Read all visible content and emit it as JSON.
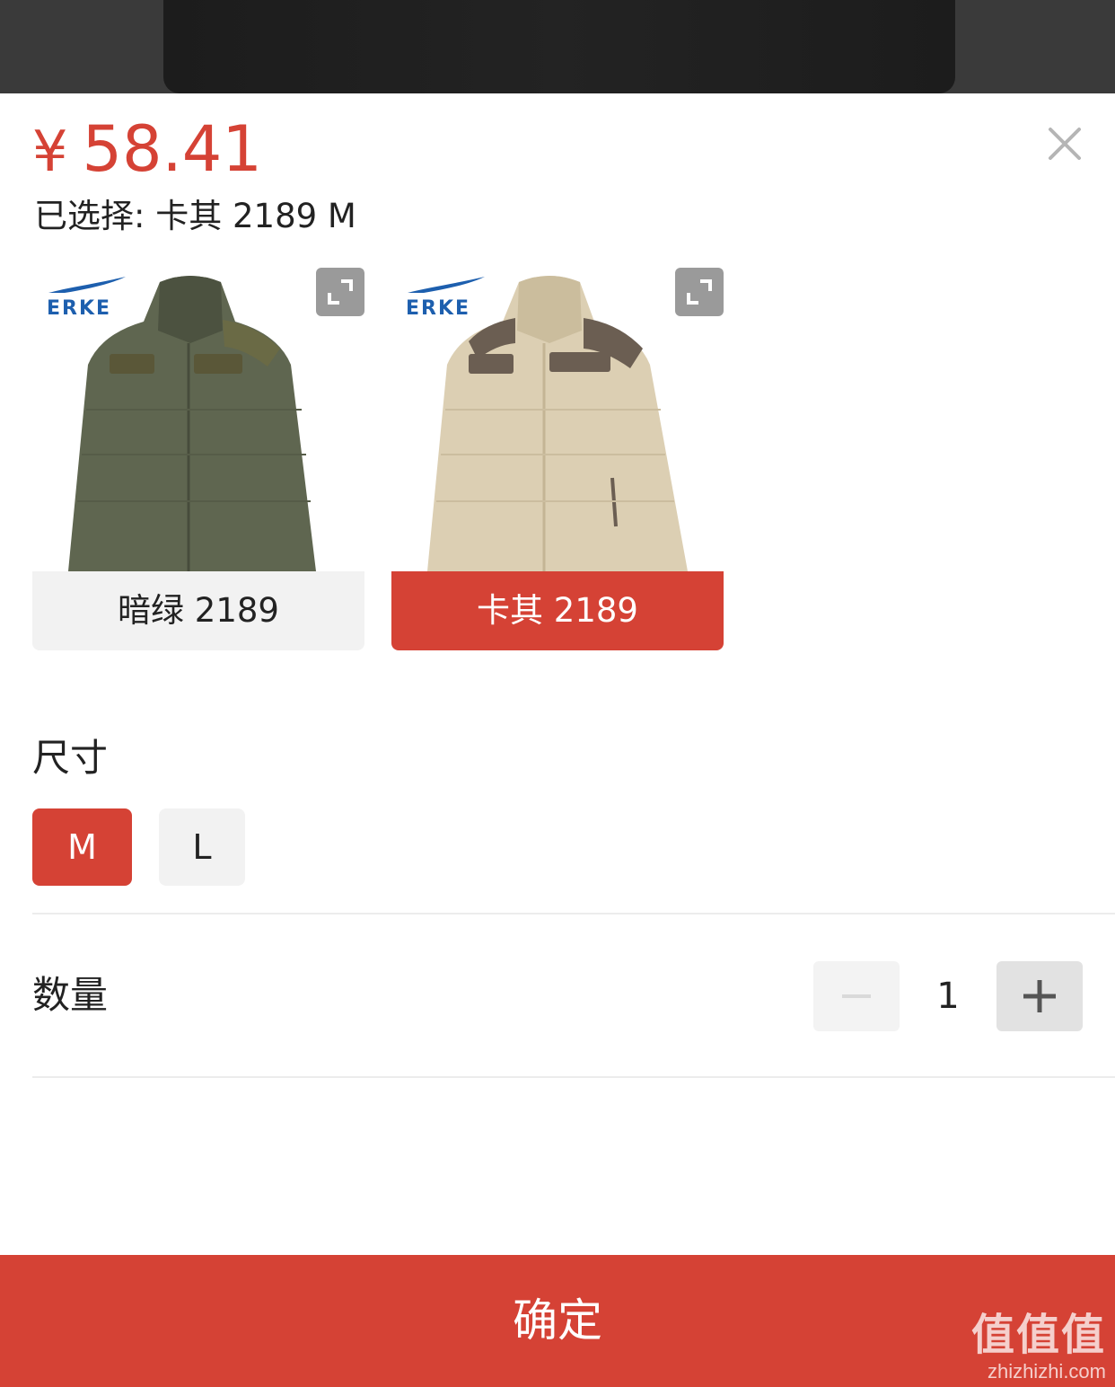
{
  "product": {
    "currency": "¥",
    "price": "58.41",
    "selected_text": "已选择: 卡其 2189 M"
  },
  "colors": [
    {
      "label": "暗绿 2189",
      "brand": "ERKE",
      "selected": false
    },
    {
      "label": "卡其 2189",
      "brand": "ERKE",
      "selected": true
    }
  ],
  "size": {
    "title": "尺寸",
    "options": [
      {
        "label": "M",
        "selected": true
      },
      {
        "label": "L",
        "selected": false
      }
    ]
  },
  "quantity": {
    "title": "数量",
    "value": "1"
  },
  "confirm_label": "确定",
  "watermark": {
    "main": "值值值",
    "url": "zhizhizhi.com"
  },
  "theme": {
    "accent": "#d54235",
    "muted": "#f2f2f2"
  },
  "icons": [
    "close-icon",
    "expand-icon",
    "minus-icon",
    "plus-icon"
  ]
}
